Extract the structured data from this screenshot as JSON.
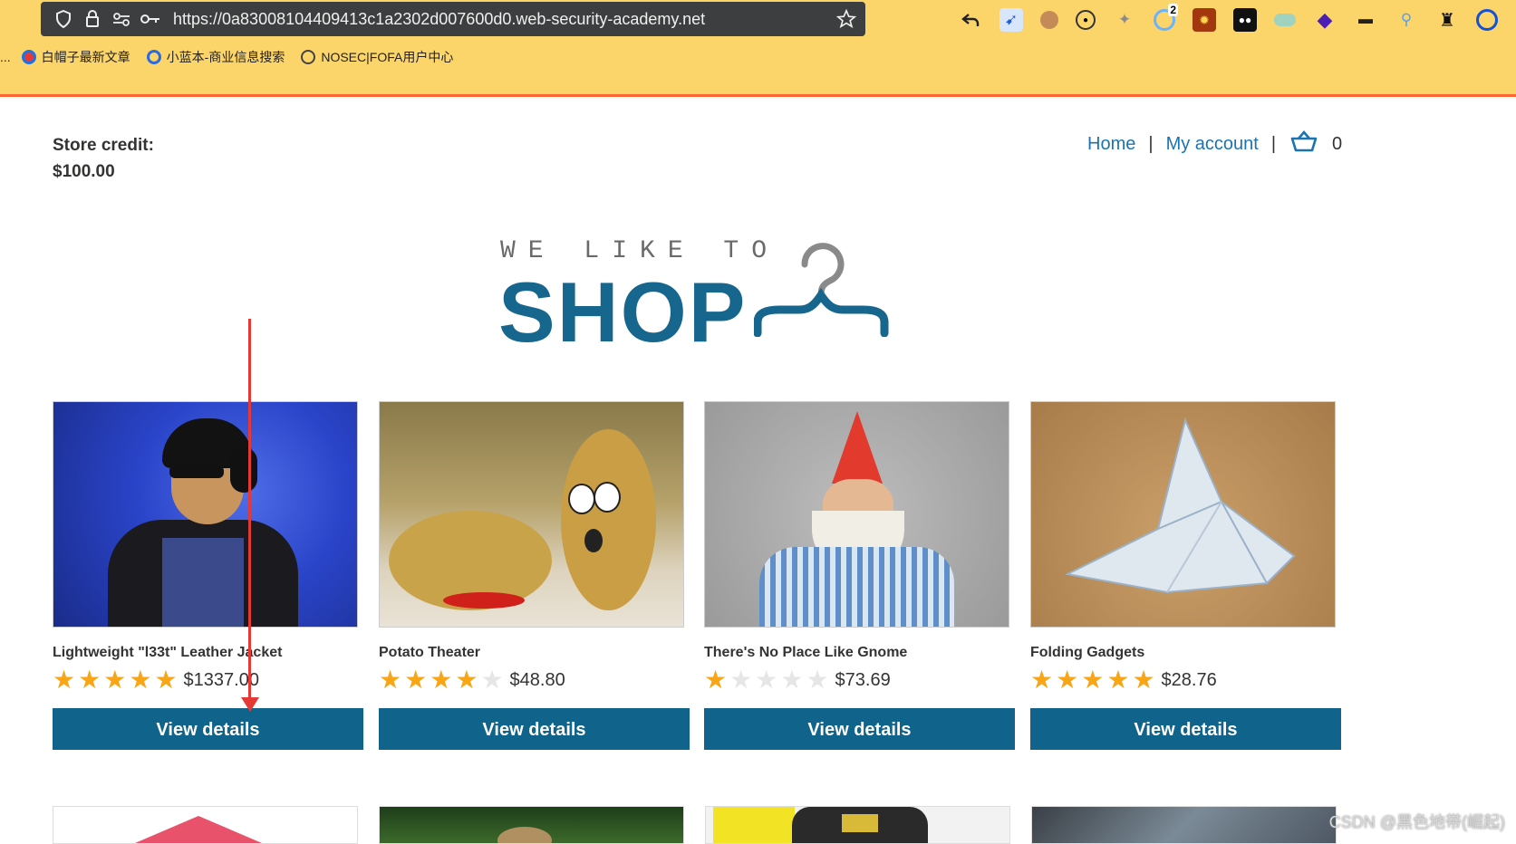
{
  "browser": {
    "url": "https://0a83008104409413c1a2302d007600d0.web-security-academy.net",
    "extensions_badge": "2",
    "bookmarks": [
      {
        "label": "白帽子最新文章",
        "color": "#1a73e8"
      },
      {
        "label": "小蓝本-商业信息搜索",
        "color": "#2a6be0"
      },
      {
        "label": "NOSEC|FOFA用户中心",
        "color": "#444444"
      }
    ],
    "bookmarks_overflow": "..."
  },
  "store": {
    "credit_label": "Store credit:",
    "credit_value": "$100.00"
  },
  "nav": {
    "home": "Home",
    "separator": "|",
    "my_account": "My account",
    "cart_count": "0"
  },
  "logo": {
    "tagline": "WE LIKE TO",
    "word": "SHOP"
  },
  "products": [
    {
      "name": "Lightweight \"l33t\" Leather Jacket",
      "rating": 5,
      "price": "$1337.00",
      "button": "View details"
    },
    {
      "name": "Potato Theater",
      "rating": 4,
      "price": "$48.80",
      "button": "View details"
    },
    {
      "name": "There's No Place Like Gnome",
      "rating": 1,
      "price": "$73.69",
      "button": "View details"
    },
    {
      "name": "Folding Gadgets",
      "rating": 5,
      "price": "$28.76",
      "button": "View details"
    }
  ],
  "watermark": "CSDN @黑色地带(崛起)",
  "colors": {
    "chrome": "#fbd46a",
    "accent_line": "#ff6633",
    "brand": "#17668d",
    "button": "#10638a",
    "link": "#1a74b3",
    "star": "#f8a516",
    "annotation_arrow": "#e53935"
  }
}
